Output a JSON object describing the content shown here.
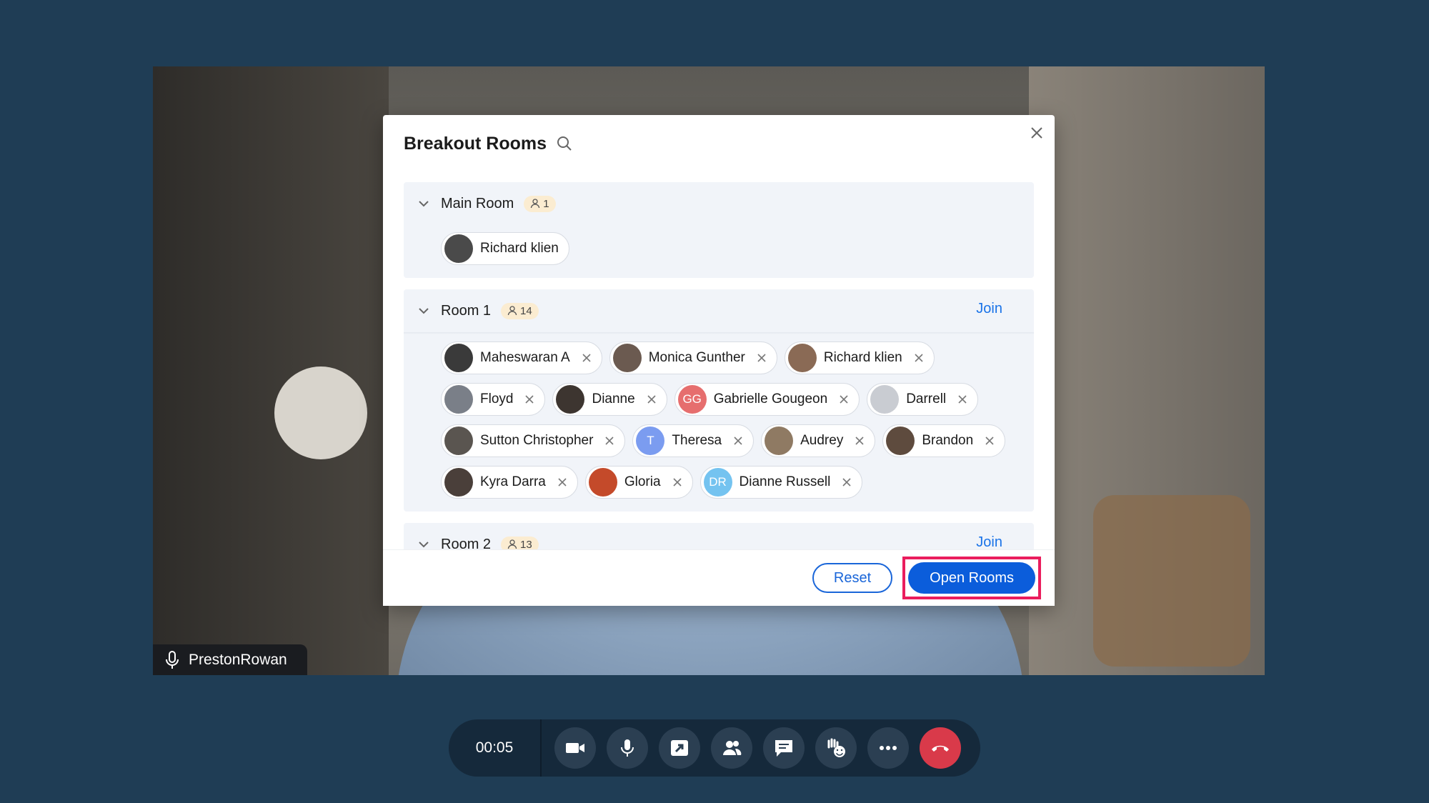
{
  "video": {
    "participant_name": "PrestonRowan"
  },
  "dialog": {
    "title": "Breakout Rooms",
    "rooms": [
      {
        "name": "Main Room",
        "count": "1",
        "join_label": "",
        "members": [
          {
            "name": "Richard klien",
            "avatar_color": "#4a4a4a",
            "initials": "",
            "removable": false
          }
        ]
      },
      {
        "name": "Room 1",
        "count": "14",
        "join_label": "Join",
        "members": [
          {
            "name": "Maheswaran A",
            "avatar_color": "#3a3a3a",
            "initials": ""
          },
          {
            "name": "Monica Gunther",
            "avatar_color": "#6b5a50",
            "initials": ""
          },
          {
            "name": "Richard klien",
            "avatar_color": "#8a6a55",
            "initials": ""
          },
          {
            "name": "Floyd",
            "avatar_color": "#7a7f88",
            "initials": ""
          },
          {
            "name": "Dianne",
            "avatar_color": "#3d3530",
            "initials": ""
          },
          {
            "name": "Gabrielle Gougeon",
            "avatar_color": "#e66e6e",
            "initials": "GG"
          },
          {
            "name": "Darrell",
            "avatar_color": "#c9ccd2",
            "initials": ""
          },
          {
            "name": "Sutton Christopher",
            "avatar_color": "#5a5550",
            "initials": ""
          },
          {
            "name": "Theresa",
            "avatar_color": "#7b9cf0",
            "initials": "T"
          },
          {
            "name": "Audrey",
            "avatar_color": "#8f7a63",
            "initials": ""
          },
          {
            "name": "Brandon",
            "avatar_color": "#5e4b3e",
            "initials": ""
          },
          {
            "name": "Kyra Darra",
            "avatar_color": "#4a3f3a",
            "initials": ""
          },
          {
            "name": "Gloria",
            "avatar_color": "#c44a2a",
            "initials": ""
          },
          {
            "name": "Dianne Russell",
            "avatar_color": "#74c3f0",
            "initials": "DR"
          }
        ]
      },
      {
        "name": "Room 2",
        "count": "13",
        "join_label": "Join",
        "members": []
      }
    ],
    "reset_label": "Reset",
    "open_rooms_label": "Open Rooms"
  },
  "toolbar": {
    "timer": "00:05",
    "buttons": [
      "video-camera-icon",
      "microphone-icon",
      "share-screen-icon",
      "participants-icon",
      "chat-icon",
      "raise-hand-icon",
      "more-icon",
      "end-call-icon"
    ],
    "end_color": "#d93a4a"
  }
}
